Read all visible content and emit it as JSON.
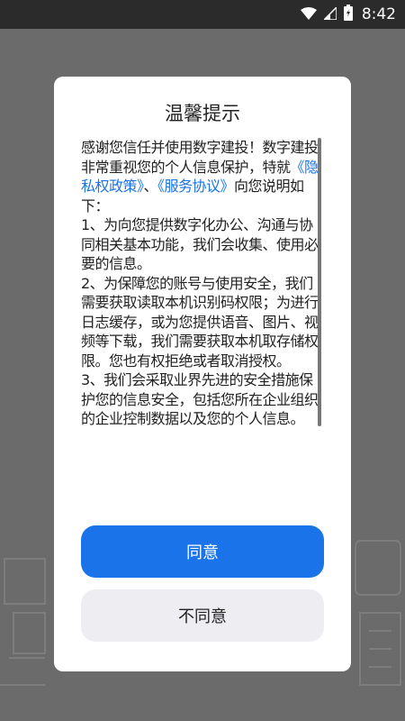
{
  "status_bar": {
    "time": "8:42",
    "icons": [
      "wifi-icon",
      "signal-icon",
      "battery-icon"
    ]
  },
  "dialog": {
    "title": "温馨提示",
    "body": [
      {
        "text": "感谢您信任并使用数字建投！数字建投非常重视您的个人信息保护，特就"
      },
      {
        "text": "《隐私权政策》",
        "link": true
      },
      {
        "text": "、"
      },
      {
        "text": "《服务协议》",
        "link": true
      },
      {
        "text": "向您说明如下："
      },
      {
        "text": "1、为向您提供数字化办公、沟通与协同相关基本功能，我们会收集、使用必要的信息。",
        "newline": true
      },
      {
        "text": "2、为保障您的账号与使用安全，我们需要获取读取本机识别码权限；为进行日志缓存，或为您提供语音、图片、视频等下载，我们需要获取本机取存储权限。您也有权拒绝或者取消授权。",
        "newline": true
      },
      {
        "text": "3、我们会采取业界先进的安全措施保护您的信息安全，包括您所在企业组织的企业控制数据以及您的个人信息。",
        "newline": true
      }
    ],
    "agree_label": "同意",
    "disagree_label": "不同意"
  },
  "colors": {
    "accent": "#1a73e8",
    "link": "#1a73e8",
    "overlay": "#6b6b6b",
    "status_bar": "#2b2b2b"
  }
}
